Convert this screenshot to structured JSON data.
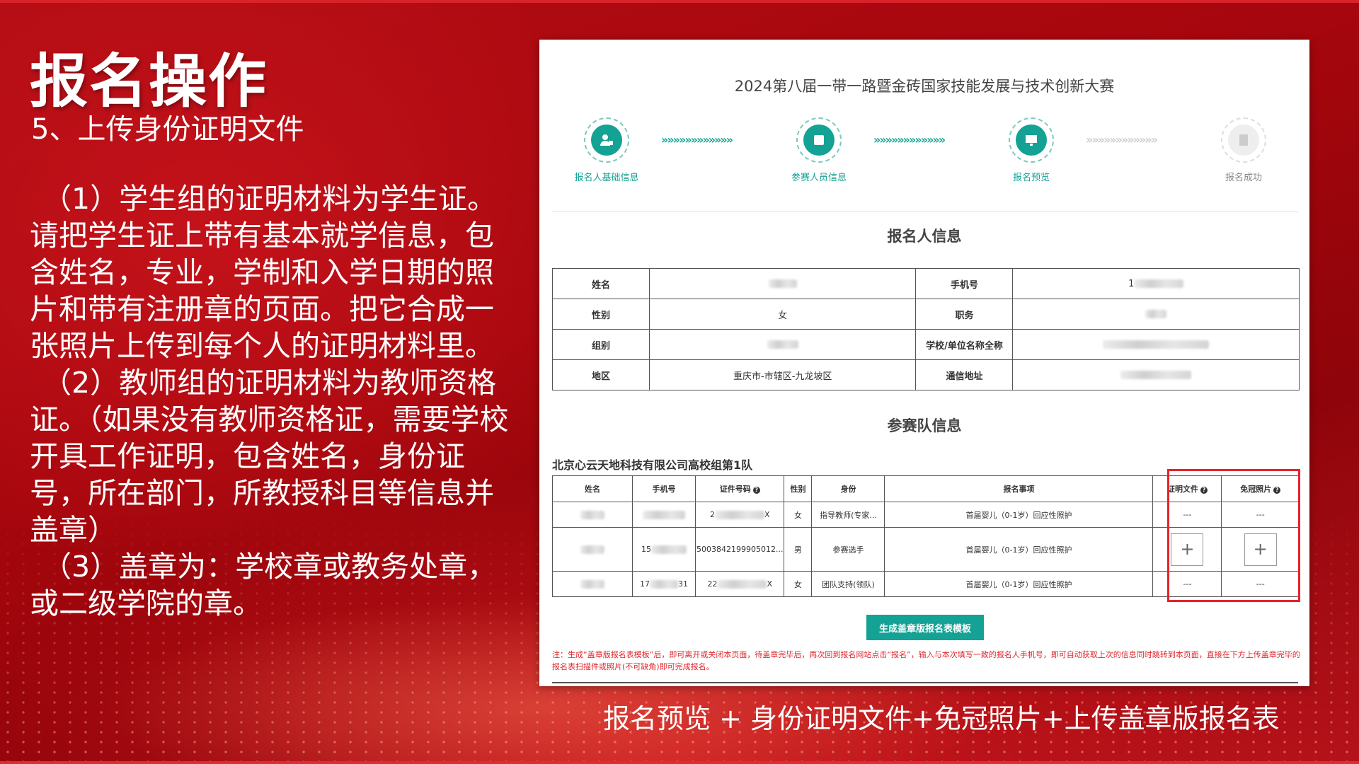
{
  "slide": {
    "title": "报名操作",
    "subtitle": "5、上传身份证明文件",
    "paragraphs": [
      "（1）学生组的证明材料为学生证。请把学生证上带有基本就学信息，包含姓名，专业，学制和入学日期的照片和带有注册章的页面。把它合成一张照片上传到每个人的证明材料里。",
      "（2）教师组的证明材料为教师资格证。（如果没有教师资格证，需要学校开具工作证明，包含姓名，身份证号，所在部门，所教授科目等信息并盖章）",
      "（3）盖章为：学校章或教务处章，或二级学院的章。"
    ],
    "caption": "报名预览 + 身份证明文件+免冠照片+上传盖章版报名表"
  },
  "screenshot": {
    "title": "2024第八届一带一路暨金砖国家技能发展与技术创新大赛",
    "steps": [
      {
        "label": "报名人基础信息",
        "icon": "person-icon",
        "active": true
      },
      {
        "label": "参赛人员信息",
        "icon": "square-icon",
        "active": true
      },
      {
        "label": "报名预览",
        "icon": "monitor-icon",
        "active": true
      },
      {
        "label": "报名成功",
        "icon": "document-icon",
        "active": false
      }
    ],
    "step_arrows": "»»»»»»»»»»»»",
    "applicant_section": "报名人信息",
    "applicant_rows": [
      {
        "k1": "姓名",
        "v1": "",
        "k2": "手机号",
        "v2": "1"
      },
      {
        "k1": "性别",
        "v1": "女",
        "k2": "职务",
        "v2": ""
      },
      {
        "k1": "组别",
        "v1": "",
        "k2": "学校/单位名称全称",
        "v2": ""
      },
      {
        "k1": "地区",
        "v1": "重庆市-市辖区-九龙坡区",
        "k2": "通信地址",
        "v2": ""
      }
    ],
    "team_section": "参赛队信息",
    "team_name": "北京心云天地科技有限公司高校组第1队",
    "team_headers": [
      "姓名",
      "手机号",
      "证件号码",
      "性别",
      "身份",
      "报名事项",
      "证明文件",
      "免冠照片"
    ],
    "team_rows": [
      {
        "phone": "",
        "id": "2",
        "id_tail": "X",
        "gender": "女",
        "role": "指导教师(专家...",
        "item": "首届婴儿（0-1岁）回应性照护",
        "proof": "---",
        "photo": "---"
      },
      {
        "phone": "15",
        "id": "5003842199905012...",
        "id_tail": "",
        "gender": "男",
        "role": "参赛选手",
        "item": "首届婴儿（0-1岁）回应性照护",
        "proof": "+",
        "photo": "+"
      },
      {
        "phone": "17",
        "phone_tail": "31",
        "id": "22",
        "id_tail": "X",
        "gender": "女",
        "role": "团队支持(领队)",
        "item": "首届婴儿（0-1岁）回应性照护",
        "proof": "---",
        "photo": "---"
      }
    ],
    "generate_button": "生成盖章版报名表模板",
    "note": "注：生成“盖章版报名表模板”后，即可离开或关闭本页面，待盖章完毕后，再次回到报名网站点击“报名”，输入与本次填写一致的报名人手机号，即可自动获取上次的信息同时跳转到本页面，直接在下方上传盖章完毕的报名表扫描件或照片(不可缺角)即可完成报名。"
  }
}
